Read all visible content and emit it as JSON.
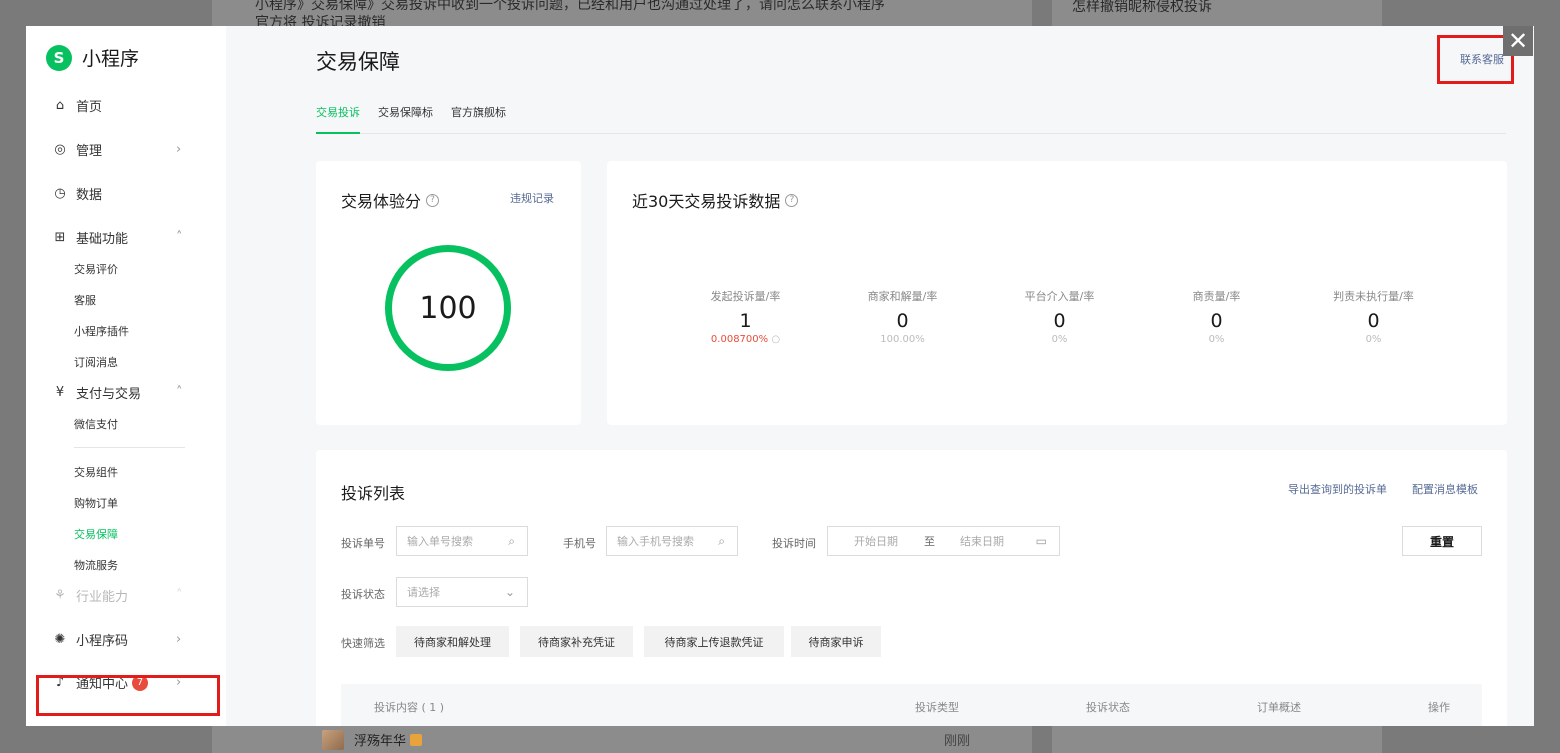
{
  "background": {
    "line1": "小程序》交易保障》交易投诉中收到一个投诉问题，已经和用户也沟通过处理了，请问怎么联系小程序",
    "line2": "官方将 投诉记录撤销",
    "right_link": "怎样撤销昵称侵权投诉",
    "row_name": "浮殇年华",
    "row_time": "刚刚"
  },
  "close_label": "✕",
  "brand": {
    "logo": "S",
    "name": "小程序"
  },
  "sidebar": {
    "home": "首页",
    "manage": "管理",
    "data": "数据",
    "basic": "基础功能",
    "basic_items": [
      "交易评价",
      "客服",
      "小程序插件",
      "订阅消息"
    ],
    "pay": "支付与交易",
    "pay_items": [
      "微信支付"
    ],
    "trade_items": [
      "交易组件",
      "购物订单",
      "交易保障",
      "物流服务"
    ],
    "industry": "行业能力",
    "qrcode": "小程序码",
    "notify": "通知中心",
    "notify_count": "7"
  },
  "header": {
    "title": "交易保障",
    "contact": "联系客服"
  },
  "tabs": [
    "交易投诉",
    "交易保障标",
    "官方旗舰标"
  ],
  "score_card": {
    "title": "交易体验分",
    "link": "违规记录",
    "score": "100"
  },
  "stats_card": {
    "title": "近30天交易投诉数据",
    "stats": [
      {
        "label": "发起投诉量/率",
        "value": "1",
        "rate": "0.008700%"
      },
      {
        "label": "商家和解量/率",
        "value": "0",
        "rate": "100.00%"
      },
      {
        "label": "平台介入量/率",
        "value": "0",
        "rate": "0%"
      },
      {
        "label": "商责量/率",
        "value": "0",
        "rate": "0%"
      },
      {
        "label": "判责未执行量/率",
        "value": "0",
        "rate": "0%"
      }
    ]
  },
  "list": {
    "title": "投诉列表",
    "export": "导出查询到的投诉单",
    "config": "配置消息模板",
    "order_label": "投诉单号",
    "order_placeholder": "输入单号搜索",
    "phone_label": "手机号",
    "phone_placeholder": "输入手机号搜索",
    "time_label": "投诉时间",
    "start_date": "开始日期",
    "to": "至",
    "end_date": "结束日期",
    "reset": "重置",
    "status_label": "投诉状态",
    "status_placeholder": "请选择",
    "quick_label": "快速筛选",
    "quick": [
      "待商家和解处理",
      "待商家补充凭证",
      "待商家上传退款凭证",
      "待商家申诉"
    ],
    "columns": [
      "投诉内容 ( 1 )",
      "投诉类型",
      "投诉状态",
      "订单概述",
      "操作"
    ]
  }
}
